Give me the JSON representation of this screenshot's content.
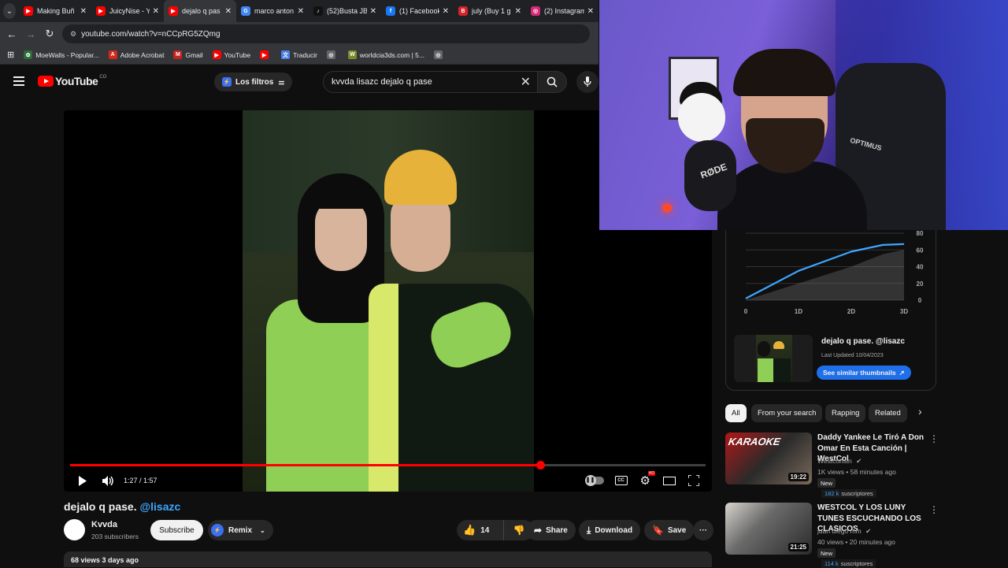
{
  "browser": {
    "tabs": [
      {
        "title": "Making Buñ",
        "favicon": "youtube",
        "color": "#ff0000"
      },
      {
        "title": "JuicyNise - Y",
        "favicon": "youtube",
        "color": "#ff0000"
      },
      {
        "title": "dejalo q pas",
        "favicon": "youtube",
        "color": "#ff0000",
        "active": true
      },
      {
        "title": "marco anton",
        "favicon": "google",
        "color": "#4285f4"
      },
      {
        "title": "(52)Busta JB",
        "favicon": "tiktok",
        "color": "#111111"
      },
      {
        "title": "(1) Facebook",
        "favicon": "facebook",
        "color": "#1877f2"
      },
      {
        "title": "july (Buy 1 g",
        "favicon": "beatstars",
        "color": "#d6222a"
      },
      {
        "title": "(2) Instagram",
        "favicon": "instagram",
        "color": "#d62976"
      }
    ],
    "url": "youtube.com/watch?v=nCCpRG5ZQmg",
    "bookmarks": [
      {
        "label": "MoeWalls - Popular...",
        "icon": "moewalls",
        "color": "#2b6b3a"
      },
      {
        "label": "Adobe Acrobat",
        "icon": "acrobat",
        "color": "#d4281c"
      },
      {
        "label": "Gmail",
        "icon": "gmail",
        "color": "#c5221f"
      },
      {
        "label": "YouTube",
        "icon": "youtube",
        "color": "#ff0000"
      },
      {
        "label": "",
        "icon": "youtube",
        "color": "#ff0000"
      },
      {
        "label": "Traducir",
        "icon": "translate",
        "color": "#4a7ee8"
      },
      {
        "label": "",
        "icon": "globe",
        "color": "#666666"
      },
      {
        "label": "worldcia3ds.com | 5...",
        "icon": "worldcia",
        "color": "#7a8a2a"
      },
      {
        "label": "",
        "icon": "globe",
        "color": "#666666"
      }
    ]
  },
  "youtube": {
    "logo_text": "YouTube",
    "logo_country": "CO",
    "filters_label": "Los filtros",
    "search_query": "kvvda lisazc dejalo q pase",
    "player": {
      "time": "1:27 / 1:57",
      "progress": 0.74
    },
    "video": {
      "title": "dejalo q pase.",
      "mention": "@lisazc",
      "channel": "Kvvda",
      "subscribers": "203 subscribers",
      "subscribe_label": "Subscribe",
      "remix_label": "Remix",
      "likes": "14",
      "share_label": "Share",
      "download_label": "Download",
      "save_label": "Save",
      "description_meta": "68 views  3 days ago"
    }
  },
  "stats_chart": {
    "chart_data": {
      "type": "line",
      "x": [
        "0",
        "1D",
        "2D",
        "3D"
      ],
      "y_ticks": [
        0,
        20,
        40,
        60,
        80
      ],
      "series": [
        {
          "values": [
            2,
            35,
            58,
            66,
            67
          ],
          "x_pos": [
            0,
            1,
            2,
            2.6,
            3
          ],
          "color": "#3ea6ff"
        },
        {
          "values": [
            0,
            20,
            40,
            55,
            60
          ],
          "x_pos": [
            0,
            1,
            2,
            2.6,
            3
          ],
          "fill": "area",
          "color": "#555555"
        }
      ],
      "ylim": [
        0,
        80
      ]
    }
  },
  "thumbnail_card": {
    "title": "dejalo q pase. @lisazc",
    "updated": "Last Updated 10/04/2023",
    "button_label": "See similar thumbnails"
  },
  "chips": [
    "All",
    "From your search",
    "Rapping",
    "Related"
  ],
  "recommendations": [
    {
      "title": "Daddy Yankee Le Tiró A Don Omar En Esta Canción | WestCol",
      "channel": "Westconsin",
      "meta": "1K views • 58 minutes ago",
      "badge": "New",
      "subs_number": "182 k",
      "subs_label": "suscriptores",
      "duration": "19:22"
    },
    {
      "title": "WESTCOL Y LOS LUNY TUNES ESCUCHANDO LOS CLASICOS",
      "channel": "juan diego mm",
      "meta": "40 views • 20 minutes ago",
      "badge": "New",
      "subs_number": "114 k",
      "subs_label": "suscriptores",
      "duration": "21:25"
    }
  ],
  "webcam": {
    "mic_brand": "RØDE",
    "chair_brand": "OPTIMUS"
  }
}
